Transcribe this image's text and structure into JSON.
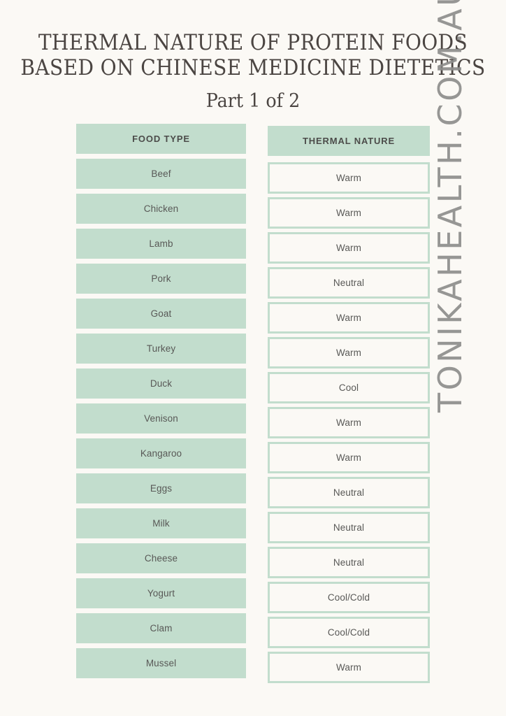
{
  "title": {
    "line1": "Thermal Nature of Protein Foods",
    "line2": "Based on Chinese Medicine Dietetics",
    "subtitle": "Part 1 of 2"
  },
  "watermark": {
    "text": "TONIKAHEALTH.COM.AU"
  },
  "colors": {
    "background": "#fbf9f5",
    "accent_green": "#c2ddcd",
    "title_text": "#4b4542",
    "body_text": "#585856",
    "watermark_text": "#8e8e8c"
  },
  "table": {
    "headers": {
      "food_type": "FOOD TYPE",
      "thermal_nature": "THERMAL NATURE"
    },
    "rows": [
      {
        "food": "Beef",
        "nature": "Warm"
      },
      {
        "food": "Chicken",
        "nature": "Warm"
      },
      {
        "food": "Lamb",
        "nature": "Warm"
      },
      {
        "food": "Pork",
        "nature": "Neutral"
      },
      {
        "food": "Goat",
        "nature": "Warm"
      },
      {
        "food": "Turkey",
        "nature": "Warm"
      },
      {
        "food": "Duck",
        "nature": "Cool"
      },
      {
        "food": "Venison",
        "nature": "Warm"
      },
      {
        "food": "Kangaroo",
        "nature": "Warm"
      },
      {
        "food": "Eggs",
        "nature": "Neutral"
      },
      {
        "food": "Milk",
        "nature": "Neutral"
      },
      {
        "food": "Cheese",
        "nature": "Neutral"
      },
      {
        "food": "Yogurt",
        "nature": "Cool/Cold"
      },
      {
        "food": "Clam",
        "nature": "Cool/Cold"
      },
      {
        "food": "Mussel",
        "nature": "Warm"
      }
    ]
  }
}
